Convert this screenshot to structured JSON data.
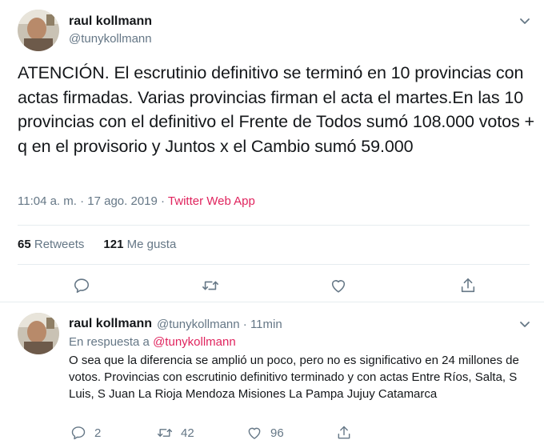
{
  "tweet": {
    "name": "raul kollmann",
    "handle": "@tunykollmann",
    "text": "ATENCIÓN. El escrutinio definitivo se terminó en 10 provincias con actas firmadas. Varias provincias firman el acta el martes.En las 10 provincias con el definitivo el Frente de Todos sumó 108.000 votos + q en el provisorio y Juntos x el Cambio sumó 59.000",
    "time": "11:04 a. m. · 17 ago. 2019 · ",
    "source": "Twitter Web App",
    "retweets_count": "65",
    "retweets_label": "Retweets",
    "likes_count": "121",
    "likes_label": "Me gusta"
  },
  "reply": {
    "name": "raul kollmann",
    "handle_time": "@tunykollmann · 11min",
    "in_reply_prefix": "En respuesta a ",
    "in_reply_mention": "@tunykollmann",
    "text": "O sea que la diferencia se amplió un poco, pero no es significativo en 24 millones de votos. Provincias con escrutinio definitivo terminado y con actas Entre Ríos, Salta, S Luis, S Juan La Rioja Mendoza Misiones La Pampa Jujuy Catamarca",
    "reply_count": "2",
    "retweet_count": "42",
    "like_count": "96"
  },
  "colors": {
    "accent": "#e0245e",
    "secondary_text": "#657786",
    "primary_text": "#14171a",
    "divider": "#e6ecf0"
  },
  "icons": [
    "chevron-down-icon",
    "reply-icon",
    "retweet-icon",
    "like-icon",
    "share-icon"
  ]
}
